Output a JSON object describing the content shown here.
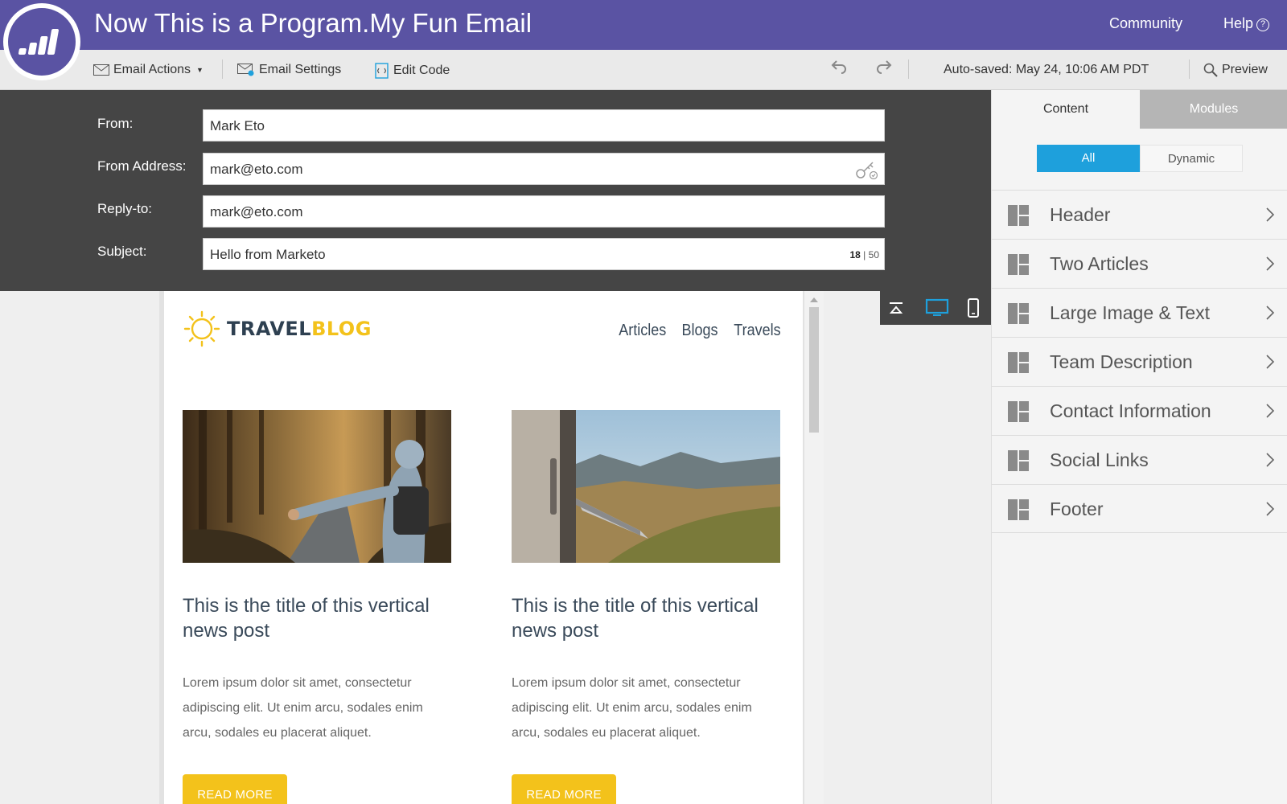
{
  "header": {
    "title": "Now This is a Program.My Fun Email",
    "community": "Community",
    "help": "Help",
    "help_badge": "?"
  },
  "toolbar": {
    "email_actions": "Email Actions",
    "email_settings": "Email Settings",
    "edit_code": "Edit Code",
    "autosaved": "Auto-saved: May 24, 10:06 AM PDT",
    "preview": "Preview"
  },
  "form": {
    "from_label": "From:",
    "from_value": "Mark Eto",
    "from_address_label": "From Address:",
    "from_address_value": "mark@eto.com",
    "reply_to_label": "Reply-to:",
    "reply_to_value": "mark@eto.com",
    "subject_label": "Subject:",
    "subject_value": "Hello from Marketo",
    "subject_count": "18",
    "subject_sep": "|",
    "subject_max": "50"
  },
  "email": {
    "brand_part1": "TRAVEL",
    "brand_part2": "BLOG",
    "nav": [
      "Articles",
      "Blogs",
      "Travels"
    ],
    "articles": [
      {
        "title": "This is the title of this vertical news post",
        "body": "Lorem ipsum dolor sit amet, consectetur adipiscing elit. Ut enim arcu, sodales enim arcu, sodales eu placerat aliquet.",
        "button": "READ MORE"
      },
      {
        "title": "This is the title of this vertical news post",
        "body": "Lorem ipsum dolor sit amet, consectetur adipiscing elit. Ut enim arcu, sodales enim arcu, sodales eu placerat aliquet.",
        "button": "READ MORE"
      }
    ]
  },
  "sidebar": {
    "tabs": [
      "Content",
      "Modules"
    ],
    "filters": [
      "All",
      "Dynamic"
    ],
    "modules": [
      "Header",
      "Two Articles",
      "Large Image & Text",
      "Team Description",
      "Contact Information",
      "Social Links",
      "Footer"
    ]
  },
  "colors": {
    "brand_purple": "#5a53a3",
    "accent_blue": "#1ea0dc",
    "cta_yellow": "#f3c21b",
    "panel_dark": "#454545"
  },
  "icons": [
    "marketo-logo-icon",
    "envelope-icon",
    "envelope-gear-icon",
    "code-file-icon",
    "undo-icon",
    "redo-icon",
    "search-icon",
    "key-icon",
    "collapse-top-icon",
    "desktop-icon",
    "mobile-icon",
    "sun-icon",
    "module-layout-icon",
    "chevron-right-icon"
  ]
}
